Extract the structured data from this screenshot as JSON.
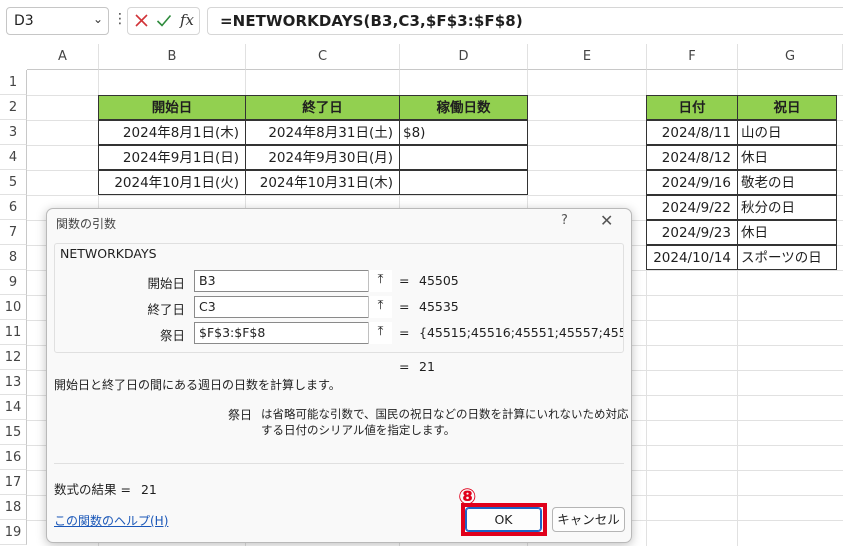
{
  "formula_bar": {
    "name_box": "D3",
    "fx_label": "fx",
    "formula": "=NETWORKDAYS(B3,C3,$F$3:$F$8)"
  },
  "columns": [
    "A",
    "B",
    "C",
    "D",
    "E",
    "F",
    "G"
  ],
  "rows": [
    "1",
    "2",
    "3",
    "4",
    "5",
    "6",
    "7",
    "8",
    "9",
    "10",
    "11",
    "12",
    "13",
    "14",
    "15",
    "16",
    "17",
    "18",
    "19"
  ],
  "table1": {
    "headers": [
      "開始日",
      "終了日",
      "稼働日数"
    ],
    "rows": [
      [
        "2024年8月1日(木)",
        "2024年8月31日(土)",
        "$8)"
      ],
      [
        "2024年9月1日(日)",
        "2024年9月30日(月)",
        ""
      ],
      [
        "2024年10月1日(火)",
        "2024年10月31日(木)",
        ""
      ]
    ]
  },
  "table2": {
    "headers": [
      "日付",
      "祝日"
    ],
    "rows": [
      [
        "2024/8/11",
        "山の日"
      ],
      [
        "2024/8/12",
        "休日"
      ],
      [
        "2024/9/16",
        "敬老の日"
      ],
      [
        "2024/9/22",
        "秋分の日"
      ],
      [
        "2024/9/23",
        "休日"
      ],
      [
        "2024/10/14",
        "スポーツの日"
      ]
    ]
  },
  "dialog": {
    "title": "関数の引数",
    "help_glyph": "?",
    "close_glyph": "✕",
    "function_name": "NETWORKDAYS",
    "args": [
      {
        "label": "開始日",
        "value": "B3",
        "result": "45505"
      },
      {
        "label": "終了日",
        "value": "C3",
        "result": "45535"
      },
      {
        "label": "祭日",
        "value": "$F$3:$F$8",
        "result": "{45515;45516;45551;45557;4555"
      }
    ],
    "equals": "=",
    "formula_result_inline": "21",
    "description": "開始日と終了日の間にある週日の日数を計算します。",
    "param_name": "祭日",
    "param_description": "は省略可能な引数で、国民の祝日などの日数を計算にいれないため対応する日付のシリアル値を指定します。",
    "result_label": "数式の結果 =",
    "result_value": "21",
    "help_link": "この関数のヘルプ(H)",
    "ok_label": "OK",
    "cancel_label": "キャンセル",
    "step_badge": "⑧"
  },
  "colors": {
    "header_green": "#92d050",
    "highlight_red": "#e0001b",
    "link_blue": "#1a57b8"
  }
}
